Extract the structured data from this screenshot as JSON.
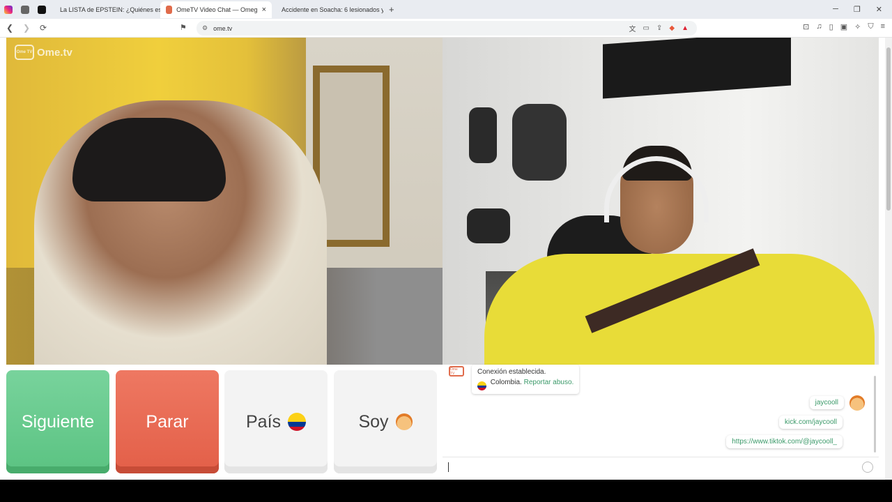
{
  "browser": {
    "tabs": [
      {
        "title": "La LISTA de EPSTEIN: ¿Quiénes están",
        "icon": "youtube-icon",
        "color": "#ff0000"
      },
      {
        "title": "OmeTV Video Chat — Omeg",
        "icon": "ometv-icon",
        "color": "#e06b4b",
        "active": true
      },
      {
        "title": "Accidente en Soacha: 6 lesionados y",
        "icon": "tiktok-icon",
        "color": "#111111"
      }
    ],
    "new_tab_label": "+",
    "close_label": "×",
    "url": "ome.tv"
  },
  "logo": {
    "text": "Ome.tv",
    "badge": "Ome TV"
  },
  "buttons": {
    "next": "Siguiente",
    "stop": "Parar",
    "country": "País",
    "gender": "Soy"
  },
  "chat": {
    "system_icon_label": "Ome TV",
    "connected": "Conexión establecida.",
    "country": "Colombia.",
    "report": "Reportar abuso.",
    "messages": [
      "jaycooll",
      "kick.com/jaycooll",
      "https://www.tiktok.com/@jaycooll_"
    ]
  },
  "colors": {
    "next": "#5bc382",
    "stop": "#e35f48",
    "link": "#3c9a6a"
  }
}
